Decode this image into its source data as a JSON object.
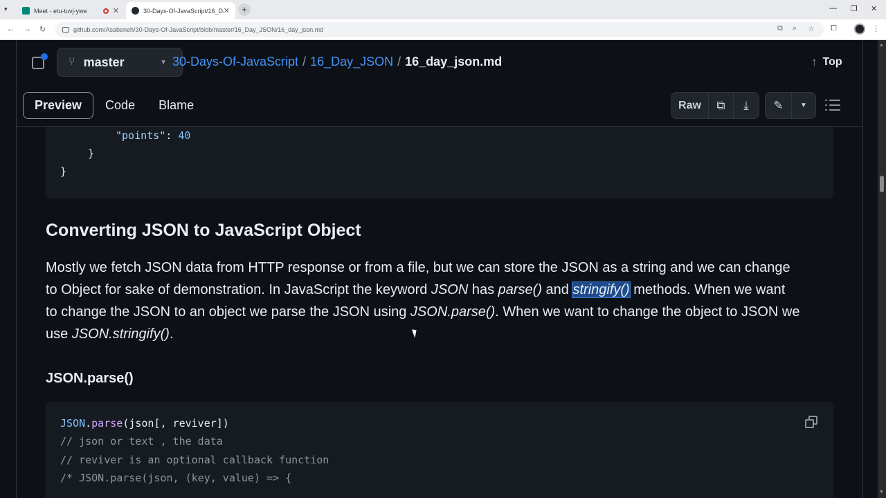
{
  "browser": {
    "tabs": [
      {
        "title": "Meet - etu-tuvj-ywe",
        "favicon_color": "#00897b"
      },
      {
        "title": "30-Days-Of-JavaScript/16_Day_",
        "favicon_color": "#24292f"
      }
    ],
    "url": "github.com/Asabeneh/30-Days-Of-JavaScript/blob/master/16_Day_JSON/16_day_json.md",
    "new_tab_glyph": "+",
    "icons": [
      "back-icon",
      "forward-icon",
      "reload-icon",
      "install-icon",
      "zoom-icon",
      "star-icon",
      "extensions-icon"
    ]
  },
  "repo_header": {
    "branch": "master",
    "breadcrumb": [
      "30-Days-Of-JavaScript",
      "16_Day_JSON"
    ],
    "separator": "/",
    "file": "16_day_json.md",
    "top_label": "Top"
  },
  "view_tabs": [
    "Preview",
    "Code",
    "Blame"
  ],
  "file_actions": {
    "raw_label": "Raw"
  },
  "top_code": {
    "key": "\"points\"",
    "colon": ": ",
    "value": "40",
    "close_inner": "}",
    "close_outer": "}"
  },
  "heading": "Converting JSON to JavaScript Object",
  "paragraph": {
    "l1": "Mostly we fetch JSON data from HTTP response or from a file, but we can store the JSON as a string and we can change",
    "l2a": "to Object for sake of demonstration. In JavaScript the keyword ",
    "l2b": "JSON",
    "l2c": " has ",
    "l2d": "parse()",
    "l2e": " and ",
    "l2f": "stringify()",
    "l2g": " methods. When we want",
    "l3a": "to change the JSON to an object we parse the JSON using ",
    "l3b": "JSON.parse()",
    "l3c": ". When we want to change the object to JSON we",
    "l4a": "use ",
    "l4b": "JSON.stringify()",
    "l4c": "."
  },
  "subheading": "JSON.parse()",
  "code_block": {
    "obj": "JSON",
    "dot": ".",
    "fn": "parse",
    "args": "(json[, reviver])",
    "comment1": "// json or text , the data",
    "comment2": "// reviver is an optional callback function",
    "comment3": "/* JSON.parse(json, (key, value) => {"
  },
  "colors": {
    "background": "#0d1117",
    "code_bg": "#161b22",
    "link": "#4493f8",
    "accent_dot": "#1f6feb",
    "selection": "#1f4b8c"
  }
}
